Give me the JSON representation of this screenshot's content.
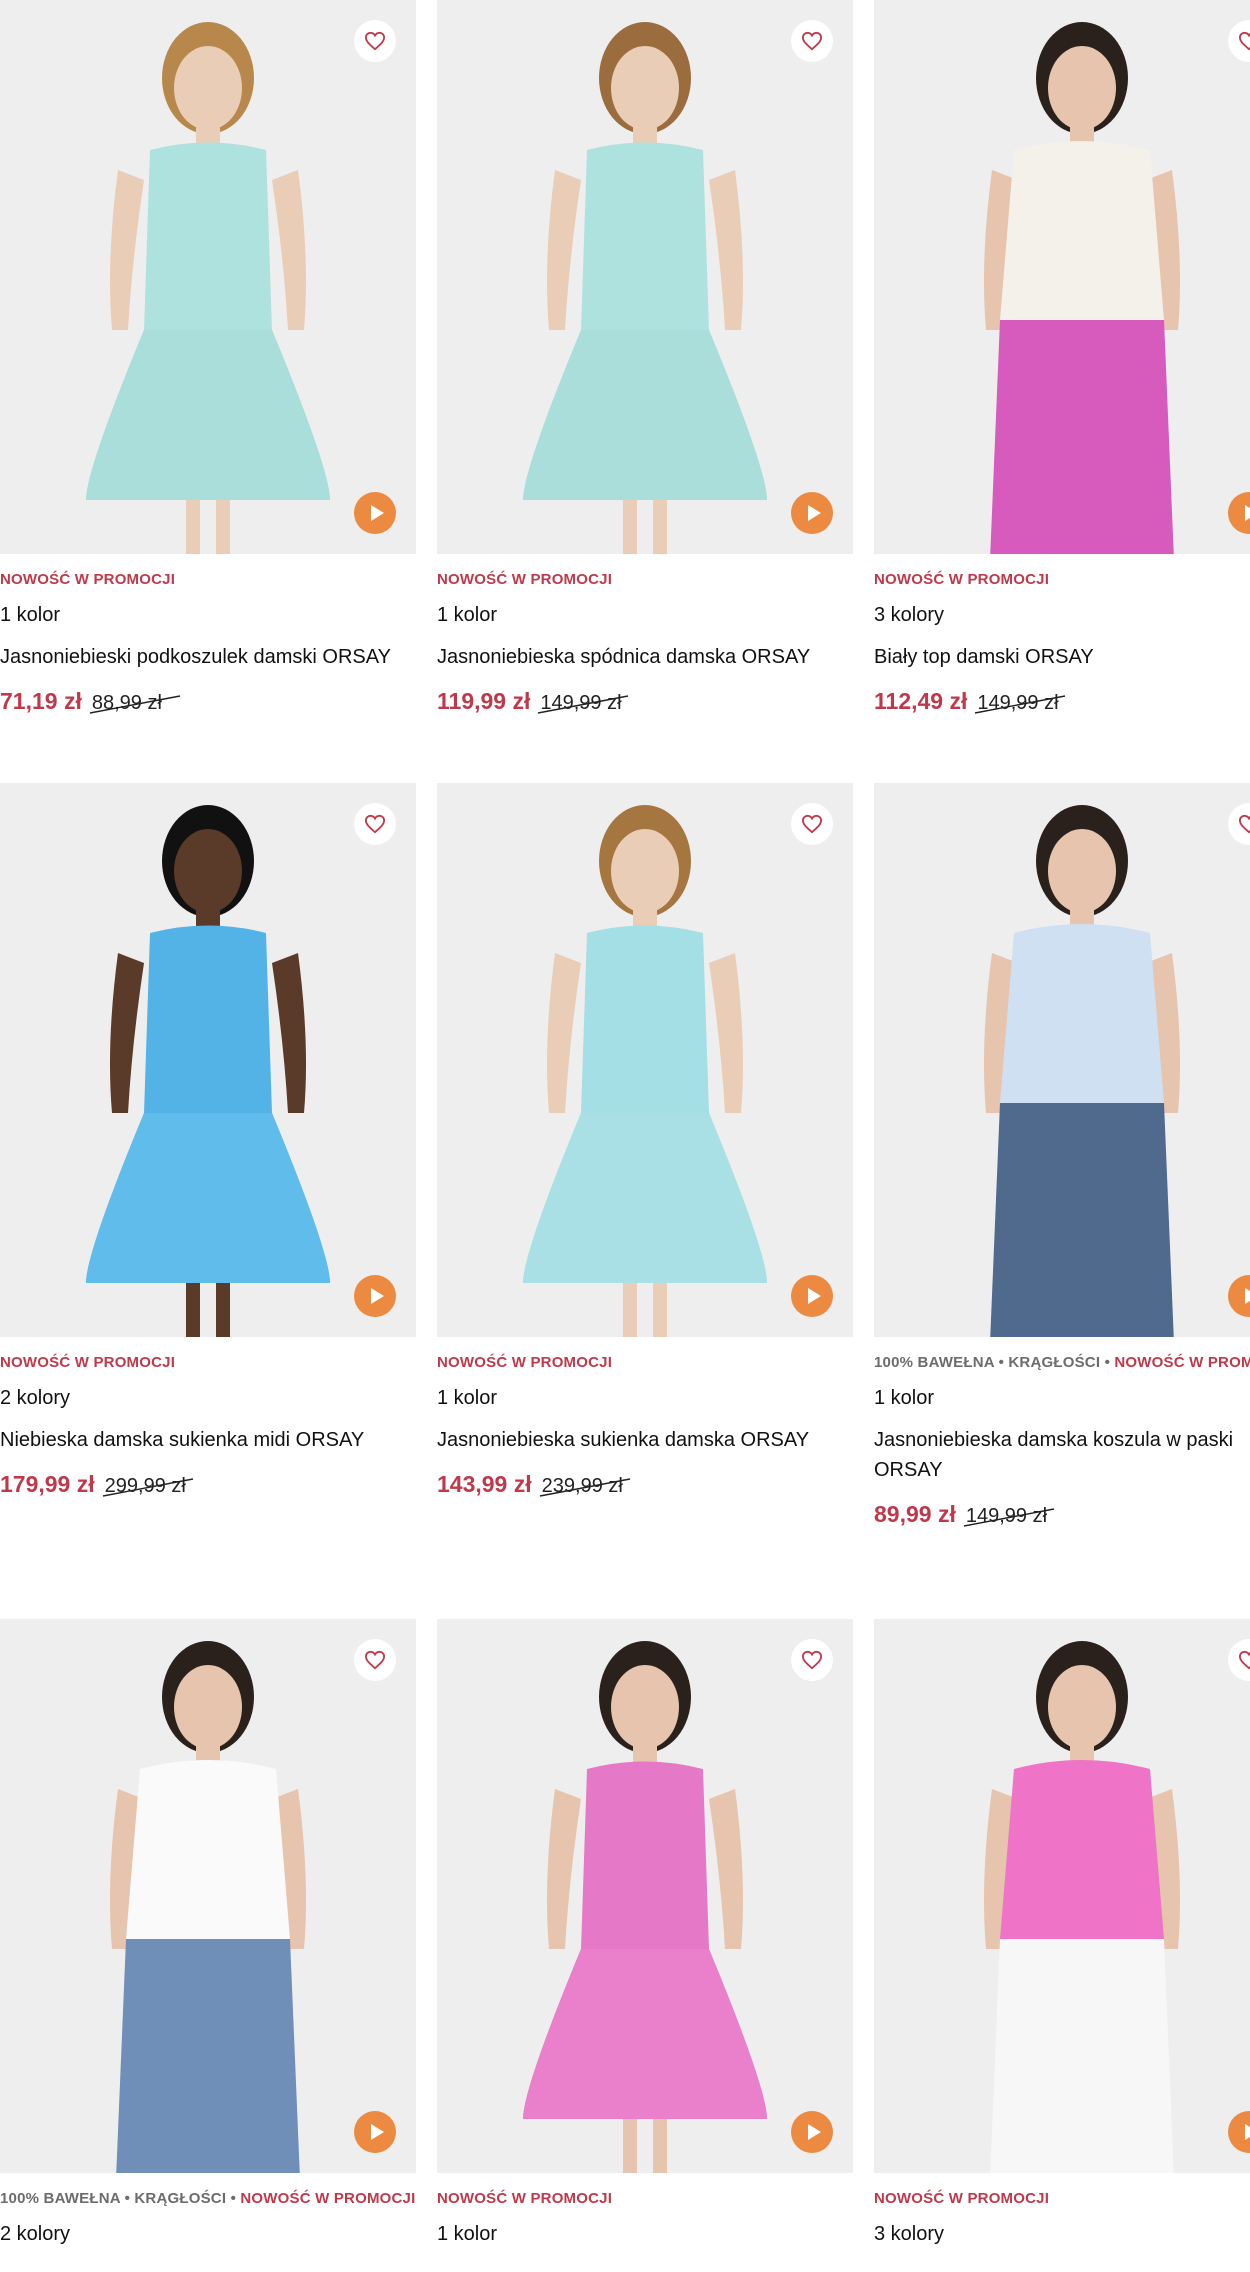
{
  "colors": {
    "promo": "#c0394a",
    "play_button": "#ec8a41",
    "image_bg": "#eeeeef"
  },
  "icons": {
    "favorite": "heart-outline-icon",
    "video": "play-icon"
  },
  "products": [
    {
      "tags": [
        {
          "text": "NOWOŚĆ W PROMOCJI",
          "style": "promo"
        }
      ],
      "colors_count": "1 kolor",
      "title": "Jasnoniebieski podkoszulek damski ORSAY",
      "price": "71,19 zł",
      "old_price": "88,99 zł",
      "figure": {
        "top": "#aee2df",
        "bottom": "#a9ded9",
        "skin": "#e9cdb7",
        "hair": "#b7874c",
        "kind": "dress"
      }
    },
    {
      "tags": [
        {
          "text": "NOWOŚĆ W PROMOCJI",
          "style": "promo"
        }
      ],
      "colors_count": "1 kolor",
      "title": "Jasnoniebieska spódnica damska ORSAY",
      "price": "119,99 zł",
      "old_price": "149,99 zł",
      "figure": {
        "top": "#aee2df",
        "bottom": "#a9ded9",
        "skin": "#e9cdb7",
        "hair": "#9a6c3e",
        "kind": "dress"
      }
    },
    {
      "tags": [
        {
          "text": "NOWOŚĆ W PROMOCJI",
          "style": "promo"
        }
      ],
      "colors_count": "3 kolory",
      "title": "Biały top damski ORSAY",
      "price": "112,49 zł",
      "old_price": "149,99 zł",
      "figure": {
        "top": "#f4f0ea",
        "bottom": "#d65bbd",
        "skin": "#e6c4ae",
        "hair": "#2a211c",
        "kind": "top"
      }
    },
    {
      "tags": [
        {
          "text": "NOWOŚĆ W PROMOCJI",
          "style": "promo"
        }
      ],
      "colors_count": "2 kolory",
      "title": "Niebieska damska sukienka midi ORSAY",
      "price": "179,99 zł",
      "old_price": "299,99 zł",
      "figure": {
        "top": "#53b3e6",
        "bottom": "#62bdeb",
        "skin": "#5a3a28",
        "hair": "#111111",
        "kind": "dress"
      }
    },
    {
      "tags": [
        {
          "text": "NOWOŚĆ W PROMOCJI",
          "style": "promo"
        }
      ],
      "colors_count": "1 kolor",
      "title": "Jasnoniebieska sukienka damska ORSAY",
      "price": "143,99 zł",
      "old_price": "239,99 zł",
      "figure": {
        "top": "#a3dfe4",
        "bottom": "#a8e0e5",
        "skin": "#e9cdb7",
        "hair": "#a5763f",
        "kind": "dress"
      }
    },
    {
      "tags": [
        {
          "text": "100% BAWEŁNA",
          "style": "plain"
        },
        {
          "text": "KRĄGŁOŚCI",
          "style": "plain"
        },
        {
          "text": "NOWOŚĆ W PROMOCJI",
          "style": "promo"
        }
      ],
      "colors_count": "1 kolor",
      "title": "Jasnoniebieska damska koszula w paski ORSAY",
      "price": "89,99 zł",
      "old_price": "149,99 zł",
      "figure": {
        "top": "#cfe0f2",
        "bottom": "#4f6a8c",
        "skin": "#e6c4ae",
        "hair": "#2a211c",
        "kind": "top"
      }
    },
    {
      "tags": [
        {
          "text": "100% BAWEŁNA",
          "style": "plain"
        },
        {
          "text": "KRĄGŁOŚCI",
          "style": "plain"
        },
        {
          "text": "NOWOŚĆ W PROMOCJI",
          "style": "promo"
        }
      ],
      "colors_count": "2 kolory",
      "title": "",
      "price": "",
      "old_price": "",
      "figure": {
        "top": "#fafafa",
        "bottom": "#6f8fb8",
        "skin": "#e6c4ae",
        "hair": "#2a211c",
        "kind": "top"
      }
    },
    {
      "tags": [
        {
          "text": "NOWOŚĆ W PROMOCJI",
          "style": "promo"
        }
      ],
      "colors_count": "1 kolor",
      "title": "",
      "price": "",
      "old_price": "",
      "figure": {
        "top": "#e678c8",
        "bottom": "#ea7fcc",
        "skin": "#e6c4ae",
        "hair": "#2a211c",
        "kind": "dress"
      }
    },
    {
      "tags": [
        {
          "text": "NOWOŚĆ W PROMOCJI",
          "style": "promo"
        }
      ],
      "colors_count": "3 kolory",
      "title": "",
      "price": "",
      "old_price": "",
      "figure": {
        "top": "#ef73c6",
        "bottom": "#f7f7f7",
        "skin": "#e6c4ae",
        "hair": "#2a211c",
        "kind": "top"
      }
    }
  ]
}
